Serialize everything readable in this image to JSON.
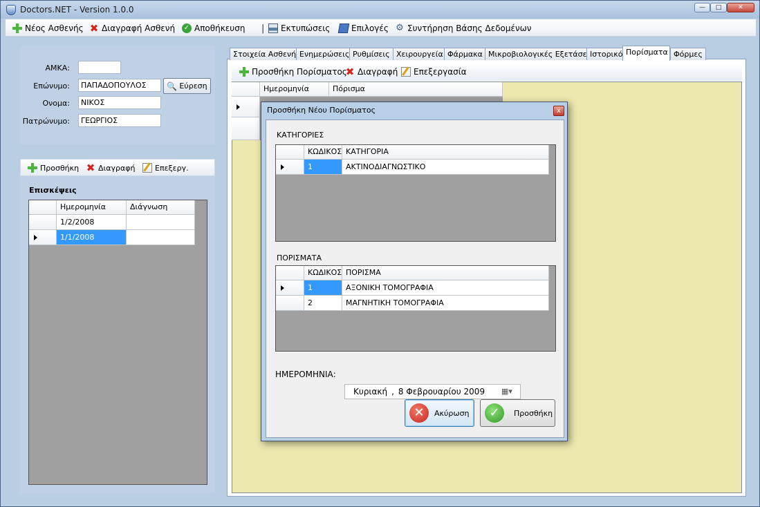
{
  "window": {
    "title": "Doctors.NET - Version 1.0.0",
    "btn_min": "—",
    "btn_max": "□",
    "btn_close": "✕"
  },
  "menu": {
    "new_patient": "Νέος Ασθενής",
    "delete_patient": "Διαγραφή Ασθενή",
    "save": "Αποθήκευση",
    "separator": "|",
    "prints": "Εκτυπώσεις",
    "options": "Επιλογές",
    "db_maintenance": "Συντήρηση Βάσης Δεδομένων"
  },
  "patient": {
    "amka_label": "ΑΜΚΑ:",
    "amka_value": "",
    "surname_label": "Επώνυμο:",
    "surname_value": "ΠΑΠΑΔΟΠΟΥΛΟΣ",
    "name_label": "Ονομα:",
    "name_value": "ΝΙΚΟΣ",
    "father_label": "Πατρώνυμο:",
    "father_value": "ΓΕΩΡΓΙΟΣ",
    "find_button": "Εύρεση"
  },
  "visits": {
    "toolbar": {
      "add": "Προσθήκη",
      "delete": "Διαγραφή",
      "edit": "Επεξεργ."
    },
    "title": "Επισκέψεις",
    "columns": [
      "Ημερομηνία",
      "Διάγνωση"
    ],
    "rows": [
      {
        "date": "1/2/2008",
        "diagnosis": ""
      },
      {
        "date": "1/1/2008",
        "diagnosis": ""
      }
    ]
  },
  "tabs": [
    "Στοιχεία Ασθενή",
    "Ενημερώσεις",
    "Ρυθμίσεις",
    "Χειρουργεία",
    "Φάρμακα",
    "Μικροβιολογικές Εξετάσεις",
    "Ιστορικό",
    "Πορίσματα",
    "Φόρμες"
  ],
  "active_tab": "Πορίσματα",
  "findings_toolbar": {
    "add": "Προσθήκη Πορίσματος",
    "delete": "Διαγραφή",
    "edit": "Επεξεργασία"
  },
  "findings_grid": {
    "columns": [
      "Ημερομηνία",
      "Πόρισμα"
    ]
  },
  "dialog": {
    "title": "Προσθήκη Νέου Πορίσματος",
    "close": "x",
    "categories": {
      "title": "ΚΑΤΗΓΟΡΙΕΣ",
      "columns": [
        "ΚΩΔΙΚΟΣ",
        "ΚΑΤΗΓΟΡΙΑ"
      ],
      "rows": [
        {
          "code": "1",
          "name": "ΑΚΤΙΝΟΔΙΑΓΝΩΣΤΙΚΟ"
        }
      ]
    },
    "findings": {
      "title": "ΠΟΡΙΣΜΑΤΑ",
      "columns": [
        "ΚΩΔΙΚΟΣ",
        "ΠΟΡΙΣΜΑ"
      ],
      "rows": [
        {
          "code": "1",
          "name": "ΑΞΟΝΙΚΗ ΤΟΜΟΓΡΑΦΙΑ"
        },
        {
          "code": "2",
          "name": "ΜΑΓΝΗΤΙΚΗ ΤΟΜΟΓΡΑΦΙΑ"
        }
      ]
    },
    "date_label": "ΗΜΕΡΟΜΗΝΙΑ:",
    "date_day": "Κυριακή",
    "date_sep": ",",
    "date_value": "8 Φεβρουαρίου 2009",
    "cancel_button": "Ακύρωση",
    "add_button": "Προσθήκη"
  }
}
